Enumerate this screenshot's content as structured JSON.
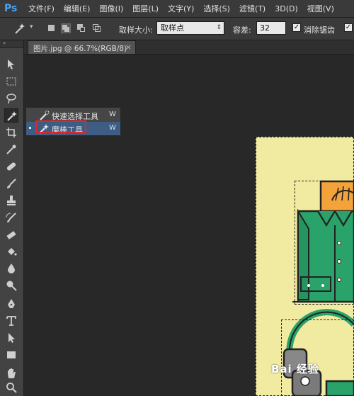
{
  "app": {
    "logo": "Ps"
  },
  "menu": [
    "文件(F)",
    "编辑(E)",
    "图像(I)",
    "图层(L)",
    "文字(Y)",
    "选择(S)",
    "滤镜(T)",
    "3D(D)",
    "视图(V)"
  ],
  "options": {
    "tool_icon": "magic-wand-icon",
    "sample_size_label": "取样大小:",
    "sample_size_value": "取样点",
    "tolerance_label": "容差:",
    "tolerance_value": "32",
    "antialias_label": "消除锯齿",
    "antialias_checked": true
  },
  "document": {
    "tab_label": "图片.jpg @ 66.7%(RGB/8)",
    "close_glyph": "×"
  },
  "tools_header": "»",
  "flyout": {
    "items": [
      {
        "label": "快速选择工具",
        "key": "W",
        "icon": "quick-selection-icon",
        "selected": false
      },
      {
        "label": "魔棒工具",
        "key": "W",
        "icon": "magic-wand-icon",
        "selected": true
      }
    ]
  },
  "watermark": "Bai 经验",
  "colors": {
    "selection_highlight": "#3e5d84",
    "annotation_box": "#e0262b",
    "canvas_bg": "#f1eba1",
    "shirt": "#2aa36a",
    "orange": "#f4a23a"
  }
}
